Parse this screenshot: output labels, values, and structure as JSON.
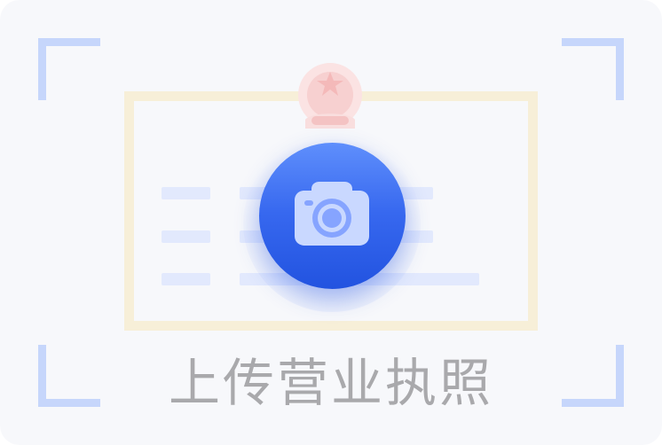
{
  "upload": {
    "caption": "上传营业执照"
  },
  "icons": {
    "camera": "camera-icon",
    "seal": "red-seal-stamp"
  },
  "colors": {
    "background": "#f7f8fb",
    "corner": "#c6d6fb",
    "license_frame": "#f7efd8",
    "text_lines": "#e2e9fd",
    "button_top": "#5f8ffc",
    "button_bottom": "#2253e0",
    "seal": "#f7c8c8",
    "caption": "#a9a9ac"
  }
}
